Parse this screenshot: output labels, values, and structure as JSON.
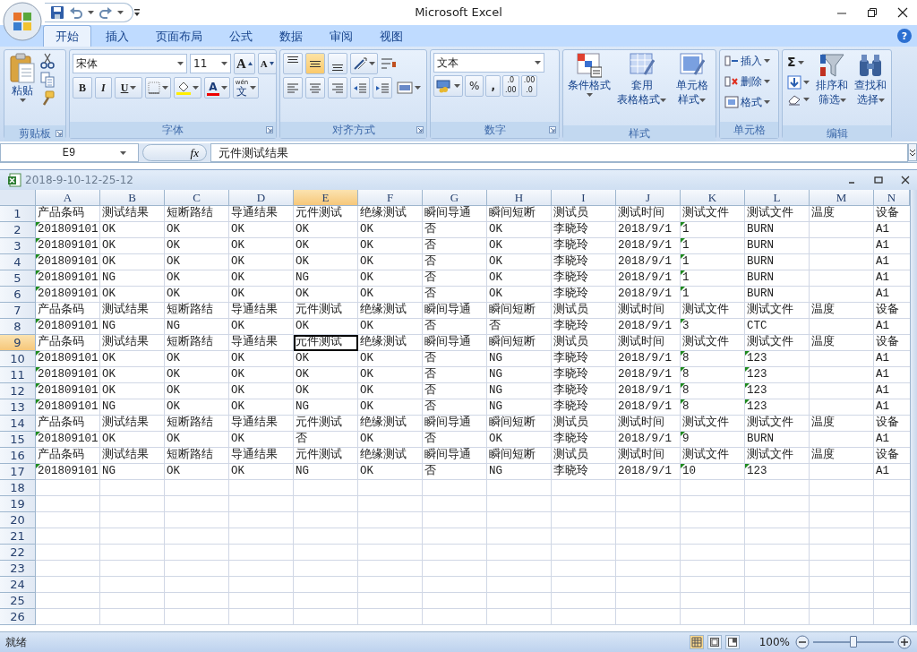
{
  "window": {
    "title": "Microsoft Excel"
  },
  "tabs": [
    {
      "label": "开始",
      "selected": true
    },
    {
      "label": "插入",
      "selected": false
    },
    {
      "label": "页面布局",
      "selected": false
    },
    {
      "label": "公式",
      "selected": false
    },
    {
      "label": "数据",
      "selected": false
    },
    {
      "label": "审阅",
      "selected": false
    },
    {
      "label": "视图",
      "selected": false
    }
  ],
  "help": "?",
  "ribbon": {
    "clipboard": {
      "label": "剪贴板",
      "paste": "粘贴"
    },
    "font": {
      "label": "字体",
      "font_name": "宋体",
      "font_size": "11",
      "grow": "A",
      "shrink": "A",
      "bold": "B",
      "italic": "I",
      "underline": "U",
      "font_color": "A",
      "phonetic_ruby": "wén",
      "phonetic": "文"
    },
    "alignment": {
      "label": "对齐方式",
      "vertical": [
        {
          "kind": "top",
          "selected": false
        },
        {
          "kind": "middle",
          "selected": true
        },
        {
          "kind": "bottom",
          "selected": false
        }
      ]
    },
    "number": {
      "label": "数字",
      "format": "文本",
      "percent": "%",
      "comma": ",",
      "increase_decimal": [
        ".0",
        ".00"
      ],
      "decrease_decimal": [
        ".00",
        ".0"
      ]
    },
    "styles": {
      "label": "样式",
      "buttons": [
        {
          "kind": "conditional",
          "lines": [
            "条件格式"
          ]
        },
        {
          "kind": "table",
          "lines": [
            "套用",
            "表格格式"
          ]
        },
        {
          "kind": "cell",
          "lines": [
            "单元格",
            "样式"
          ]
        }
      ]
    },
    "cells": {
      "label": "单元格",
      "buttons": [
        {
          "kind": "insert",
          "label": "插入"
        },
        {
          "kind": "delete",
          "label": "删除"
        },
        {
          "kind": "format",
          "label": "格式"
        }
      ]
    },
    "editing": {
      "label": "编辑",
      "sum": "Σ",
      "buttons": [
        {
          "kind": "sort",
          "lines": [
            "排序和",
            "筛选"
          ]
        },
        {
          "kind": "find",
          "lines": [
            "查找和",
            "选择"
          ]
        }
      ]
    }
  },
  "formula_bar": {
    "name_box": "E9",
    "function_button": "fx",
    "value": "元件测试结果"
  },
  "workbook": {
    "title": "2018-9-10-12-25-12"
  },
  "columns": [
    {
      "label": "A",
      "selected": false
    },
    {
      "label": "B",
      "selected": false
    },
    {
      "label": "C",
      "selected": false
    },
    {
      "label": "D",
      "selected": false
    },
    {
      "label": "E",
      "selected": true
    },
    {
      "label": "F",
      "selected": false
    },
    {
      "label": "G",
      "selected": false
    },
    {
      "label": "H",
      "selected": false
    },
    {
      "label": "I",
      "selected": false
    },
    {
      "label": "J",
      "selected": false
    },
    {
      "label": "K",
      "selected": false
    },
    {
      "label": "L",
      "selected": false
    },
    {
      "label": "M",
      "selected": false
    },
    {
      "label": "N",
      "selected": false
    }
  ],
  "rows": [
    {
      "number": "1",
      "selected": false,
      "cells": [
        "产品条码",
        "测试结果",
        "短断路结",
        "导通结果",
        "元件测试",
        "绝缘测试",
        "瞬间导通",
        "瞬间短断",
        "测试员",
        "测试时间",
        "测试文件",
        "测试文件",
        "温度",
        "设备"
      ]
    },
    {
      "number": "2",
      "selected": false,
      "cells": [
        {
          "kind": "text",
          "text": "201809101",
          "marked": true
        },
        {
          "kind": "text",
          "text": "OK",
          "marked": false
        },
        {
          "kind": "text",
          "text": "OK",
          "marked": false
        },
        {
          "kind": "text",
          "text": "OK",
          "marked": false
        },
        {
          "kind": "text",
          "text": "OK",
          "marked": false
        },
        {
          "kind": "text",
          "text": "OK",
          "marked": false
        },
        {
          "kind": "text",
          "text": "否",
          "marked": false
        },
        {
          "kind": "text",
          "text": "OK",
          "marked": false
        },
        {
          "kind": "text",
          "text": "李晓玲",
          "marked": false
        },
        {
          "kind": "text",
          "text": "2018/9/1",
          "marked": false
        },
        {
          "kind": "text",
          "text": "1",
          "marked": true
        },
        {
          "kind": "text",
          "text": "BURN",
          "marked": false
        },
        {
          "kind": "empty"
        },
        {
          "kind": "text",
          "text": "A1",
          "marked": false
        }
      ]
    },
    {
      "number": "3",
      "selected": false,
      "cells": [
        {
          "kind": "text",
          "text": "201809101",
          "marked": true
        },
        {
          "kind": "text",
          "text": "OK",
          "marked": false
        },
        {
          "kind": "text",
          "text": "OK",
          "marked": false
        },
        {
          "kind": "text",
          "text": "OK",
          "marked": false
        },
        {
          "kind": "text",
          "text": "OK",
          "marked": false
        },
        {
          "kind": "text",
          "text": "OK",
          "marked": false
        },
        {
          "kind": "text",
          "text": "否",
          "marked": false
        },
        {
          "kind": "text",
          "text": "OK",
          "marked": false
        },
        {
          "kind": "text",
          "text": "李晓玲",
          "marked": false
        },
        {
          "kind": "text",
          "text": "2018/9/1",
          "marked": false
        },
        {
          "kind": "text",
          "text": "1",
          "marked": true
        },
        {
          "kind": "text",
          "text": "BURN",
          "marked": false
        },
        {
          "kind": "empty"
        },
        {
          "kind": "text",
          "text": "A1",
          "marked": false
        }
      ]
    },
    {
      "number": "4",
      "selected": false,
      "cells": [
        {
          "kind": "text",
          "text": "201809101",
          "marked": true
        },
        {
          "kind": "text",
          "text": "OK",
          "marked": false
        },
        {
          "kind": "text",
          "text": "OK",
          "marked": false
        },
        {
          "kind": "text",
          "text": "OK",
          "marked": false
        },
        {
          "kind": "text",
          "text": "OK",
          "marked": false
        },
        {
          "kind": "text",
          "text": "OK",
          "marked": false
        },
        {
          "kind": "text",
          "text": "否",
          "marked": false
        },
        {
          "kind": "text",
          "text": "OK",
          "marked": false
        },
        {
          "kind": "text",
          "text": "李晓玲",
          "marked": false
        },
        {
          "kind": "text",
          "text": "2018/9/1",
          "marked": false
        },
        {
          "kind": "text",
          "text": "1",
          "marked": true
        },
        {
          "kind": "text",
          "text": "BURN",
          "marked": false
        },
        {
          "kind": "empty"
        },
        {
          "kind": "text",
          "text": "A1",
          "marked": false
        }
      ]
    },
    {
      "number": "5",
      "selected": false,
      "cells": [
        {
          "kind": "text",
          "text": "201809101",
          "marked": true
        },
        {
          "kind": "text",
          "text": "NG",
          "marked": false
        },
        {
          "kind": "text",
          "text": "OK",
          "marked": false
        },
        {
          "kind": "text",
          "text": "OK",
          "marked": false
        },
        {
          "kind": "text",
          "text": "NG",
          "marked": false
        },
        {
          "kind": "text",
          "text": "OK",
          "marked": false
        },
        {
          "kind": "text",
          "text": "否",
          "marked": false
        },
        {
          "kind": "text",
          "text": "OK",
          "marked": false
        },
        {
          "kind": "text",
          "text": "李晓玲",
          "marked": false
        },
        {
          "kind": "text",
          "text": "2018/9/1",
          "marked": false
        },
        {
          "kind": "text",
          "text": "1",
          "marked": true
        },
        {
          "kind": "text",
          "text": "BURN",
          "marked": false
        },
        {
          "kind": "empty"
        },
        {
          "kind": "text",
          "text": "A1",
          "marked": false
        }
      ]
    },
    {
      "number": "6",
      "selected": false,
      "cells": [
        {
          "kind": "text",
          "text": "201809101",
          "marked": true
        },
        {
          "kind": "text",
          "text": "OK",
          "marked": false
        },
        {
          "kind": "text",
          "text": "OK",
          "marked": false
        },
        {
          "kind": "text",
          "text": "OK",
          "marked": false
        },
        {
          "kind": "text",
          "text": "OK",
          "marked": false
        },
        {
          "kind": "text",
          "text": "OK",
          "marked": false
        },
        {
          "kind": "text",
          "text": "否",
          "marked": false
        },
        {
          "kind": "text",
          "text": "OK",
          "marked": false
        },
        {
          "kind": "text",
          "text": "李晓玲",
          "marked": false
        },
        {
          "kind": "text",
          "text": "2018/9/1",
          "marked": false
        },
        {
          "kind": "text",
          "text": "1",
          "marked": true
        },
        {
          "kind": "text",
          "text": "BURN",
          "marked": false
        },
        {
          "kind": "empty"
        },
        {
          "kind": "text",
          "text": "A1",
          "marked": false
        }
      ]
    },
    {
      "number": "7",
      "selected": false,
      "cells": [
        "产品条码",
        "测试结果",
        "短断路结",
        "导通结果",
        "元件测试",
        "绝缘测试",
        "瞬间导通",
        "瞬间短断",
        "测试员",
        "测试时间",
        "测试文件",
        "测试文件",
        "温度",
        "设备"
      ]
    },
    {
      "number": "8",
      "selected": false,
      "cells": [
        {
          "kind": "text",
          "text": "201809101",
          "marked": true
        },
        {
          "kind": "text",
          "text": "NG",
          "marked": false
        },
        {
          "kind": "text",
          "text": "NG",
          "marked": false
        },
        {
          "kind": "text",
          "text": "OK",
          "marked": false
        },
        {
          "kind": "text",
          "text": "OK",
          "marked": false
        },
        {
          "kind": "text",
          "text": "OK",
          "marked": false
        },
        {
          "kind": "text",
          "text": "否",
          "marked": false
        },
        {
          "kind": "text",
          "text": "否",
          "marked": false
        },
        {
          "kind": "text",
          "text": "李晓玲",
          "marked": false
        },
        {
          "kind": "text",
          "text": "2018/9/1",
          "marked": false
        },
        {
          "kind": "text",
          "text": "3",
          "marked": true
        },
        {
          "kind": "text",
          "text": "CTC",
          "marked": false
        },
        {
          "kind": "empty"
        },
        {
          "kind": "text",
          "text": "A1",
          "marked": false
        }
      ]
    },
    {
      "number": "9",
      "selected": true,
      "cells": [
        "产品条码",
        "测试结果",
        "短断路结",
        "导通结果",
        "元件测试",
        "绝缘测试",
        "瞬间导通",
        "瞬间短断",
        "测试员",
        "测试时间",
        "测试文件",
        "测试文件",
        "温度",
        "设备"
      ]
    },
    {
      "number": "10",
      "selected": false,
      "cells": [
        {
          "kind": "text",
          "text": "201809101",
          "marked": true
        },
        {
          "kind": "text",
          "text": "OK",
          "marked": false
        },
        {
          "kind": "text",
          "text": "OK",
          "marked": false
        },
        {
          "kind": "text",
          "text": "OK",
          "marked": false
        },
        {
          "kind": "text",
          "text": "OK",
          "marked": false
        },
        {
          "kind": "text",
          "text": "OK",
          "marked": false
        },
        {
          "kind": "text",
          "text": "否",
          "marked": false
        },
        {
          "kind": "text",
          "text": "NG",
          "marked": false
        },
        {
          "kind": "text",
          "text": "李晓玲",
          "marked": false
        },
        {
          "kind": "text",
          "text": "2018/9/1",
          "marked": false
        },
        {
          "kind": "text",
          "text": "8",
          "marked": true
        },
        {
          "kind": "text",
          "text": "123",
          "marked": true
        },
        {
          "kind": "empty"
        },
        {
          "kind": "text",
          "text": "A1",
          "marked": false
        }
      ]
    },
    {
      "number": "11",
      "selected": false,
      "cells": [
        {
          "kind": "text",
          "text": "201809101",
          "marked": true
        },
        {
          "kind": "text",
          "text": "OK",
          "marked": false
        },
        {
          "kind": "text",
          "text": "OK",
          "marked": false
        },
        {
          "kind": "text",
          "text": "OK",
          "marked": false
        },
        {
          "kind": "text",
          "text": "OK",
          "marked": false
        },
        {
          "kind": "text",
          "text": "OK",
          "marked": false
        },
        {
          "kind": "text",
          "text": "否",
          "marked": false
        },
        {
          "kind": "text",
          "text": "NG",
          "marked": false
        },
        {
          "kind": "text",
          "text": "李晓玲",
          "marked": false
        },
        {
          "kind": "text",
          "text": "2018/9/1",
          "marked": false
        },
        {
          "kind": "text",
          "text": "8",
          "marked": true
        },
        {
          "kind": "text",
          "text": "123",
          "marked": true
        },
        {
          "kind": "empty"
        },
        {
          "kind": "text",
          "text": "A1",
          "marked": false
        }
      ]
    },
    {
      "number": "12",
      "selected": false,
      "cells": [
        {
          "kind": "text",
          "text": "201809101",
          "marked": true
        },
        {
          "kind": "text",
          "text": "OK",
          "marked": false
        },
        {
          "kind": "text",
          "text": "OK",
          "marked": false
        },
        {
          "kind": "text",
          "text": "OK",
          "marked": false
        },
        {
          "kind": "text",
          "text": "OK",
          "marked": false
        },
        {
          "kind": "text",
          "text": "OK",
          "marked": false
        },
        {
          "kind": "text",
          "text": "否",
          "marked": false
        },
        {
          "kind": "text",
          "text": "NG",
          "marked": false
        },
        {
          "kind": "text",
          "text": "李晓玲",
          "marked": false
        },
        {
          "kind": "text",
          "text": "2018/9/1",
          "marked": false
        },
        {
          "kind": "text",
          "text": "8",
          "marked": true
        },
        {
          "kind": "text",
          "text": "123",
          "marked": true
        },
        {
          "kind": "empty"
        },
        {
          "kind": "text",
          "text": "A1",
          "marked": false
        }
      ]
    },
    {
      "number": "13",
      "selected": false,
      "cells": [
        {
          "kind": "text",
          "text": "201809101",
          "marked": true
        },
        {
          "kind": "text",
          "text": "NG",
          "marked": false
        },
        {
          "kind": "text",
          "text": "OK",
          "marked": false
        },
        {
          "kind": "text",
          "text": "OK",
          "marked": false
        },
        {
          "kind": "text",
          "text": "NG",
          "marked": false
        },
        {
          "kind": "text",
          "text": "OK",
          "marked": false
        },
        {
          "kind": "text",
          "text": "否",
          "marked": false
        },
        {
          "kind": "text",
          "text": "NG",
          "marked": false
        },
        {
          "kind": "text",
          "text": "李晓玲",
          "marked": false
        },
        {
          "kind": "text",
          "text": "2018/9/1",
          "marked": false
        },
        {
          "kind": "text",
          "text": "8",
          "marked": true
        },
        {
          "kind": "text",
          "text": "123",
          "marked": true
        },
        {
          "kind": "empty"
        },
        {
          "kind": "text",
          "text": "A1",
          "marked": false
        }
      ]
    },
    {
      "number": "14",
      "selected": false,
      "cells": [
        "产品条码",
        "测试结果",
        "短断路结",
        "导通结果",
        "元件测试",
        "绝缘测试",
        "瞬间导通",
        "瞬间短断",
        "测试员",
        "测试时间",
        "测试文件",
        "测试文件",
        "温度",
        "设备"
      ]
    },
    {
      "number": "15",
      "selected": false,
      "cells": [
        {
          "kind": "text",
          "text": "201809101",
          "marked": true
        },
        {
          "kind": "text",
          "text": "OK",
          "marked": false
        },
        {
          "kind": "text",
          "text": "OK",
          "marked": false
        },
        {
          "kind": "text",
          "text": "OK",
          "marked": false
        },
        {
          "kind": "text",
          "text": "否",
          "marked": false
        },
        {
          "kind": "text",
          "text": "OK",
          "marked": false
        },
        {
          "kind": "text",
          "text": "否",
          "marked": false
        },
        {
          "kind": "text",
          "text": "OK",
          "marked": false
        },
        {
          "kind": "text",
          "text": "李晓玲",
          "marked": false
        },
        {
          "kind": "text",
          "text": "2018/9/1",
          "marked": false
        },
        {
          "kind": "text",
          "text": "9",
          "marked": true
        },
        {
          "kind": "text",
          "text": "BURN",
          "marked": false
        },
        {
          "kind": "empty"
        },
        {
          "kind": "text",
          "text": "A1",
          "marked": false
        }
      ]
    },
    {
      "number": "16",
      "selected": false,
      "cells": [
        "产品条码",
        "测试结果",
        "短断路结",
        "导通结果",
        "元件测试",
        "绝缘测试",
        "瞬间导通",
        "瞬间短断",
        "测试员",
        "测试时间",
        "测试文件",
        "测试文件",
        "温度",
        "设备"
      ]
    },
    {
      "number": "17",
      "selected": false,
      "cells": [
        {
          "kind": "text",
          "text": "201809101",
          "marked": true
        },
        {
          "kind": "text",
          "text": "NG",
          "marked": false
        },
        {
          "kind": "text",
          "text": "OK",
          "marked": false
        },
        {
          "kind": "text",
          "text": "OK",
          "marked": false
        },
        {
          "kind": "text",
          "text": "NG",
          "marked": false
        },
        {
          "kind": "text",
          "text": "OK",
          "marked": false
        },
        {
          "kind": "text",
          "text": "否",
          "marked": false
        },
        {
          "kind": "text",
          "text": "NG",
          "marked": false
        },
        {
          "kind": "text",
          "text": "李晓玲",
          "marked": false
        },
        {
          "kind": "text",
          "text": "2018/9/1",
          "marked": false
        },
        {
          "kind": "text",
          "text": "10",
          "marked": true
        },
        {
          "kind": "text",
          "text": "123",
          "marked": true
        },
        {
          "kind": "empty"
        },
        {
          "kind": "text",
          "text": "A1",
          "marked": false
        }
      ]
    },
    {
      "number": "18",
      "selected": false
    },
    {
      "number": "19",
      "selected": false
    },
    {
      "number": "20",
      "selected": false
    },
    {
      "number": "21",
      "selected": false
    },
    {
      "number": "22",
      "selected": false
    },
    {
      "number": "23",
      "selected": false
    },
    {
      "number": "24",
      "selected": false
    },
    {
      "number": "25",
      "selected": false
    },
    {
      "number": "26",
      "selected": false
    }
  ],
  "status_bar": {
    "status": "就绪",
    "views": [
      {
        "kind": "normal",
        "selected": true
      },
      {
        "kind": "page_layout",
        "selected": false
      },
      {
        "kind": "page_break",
        "selected": false
      }
    ],
    "zoom": "100%",
    "zoom_slider": {
      "level": 0.5
    }
  }
}
